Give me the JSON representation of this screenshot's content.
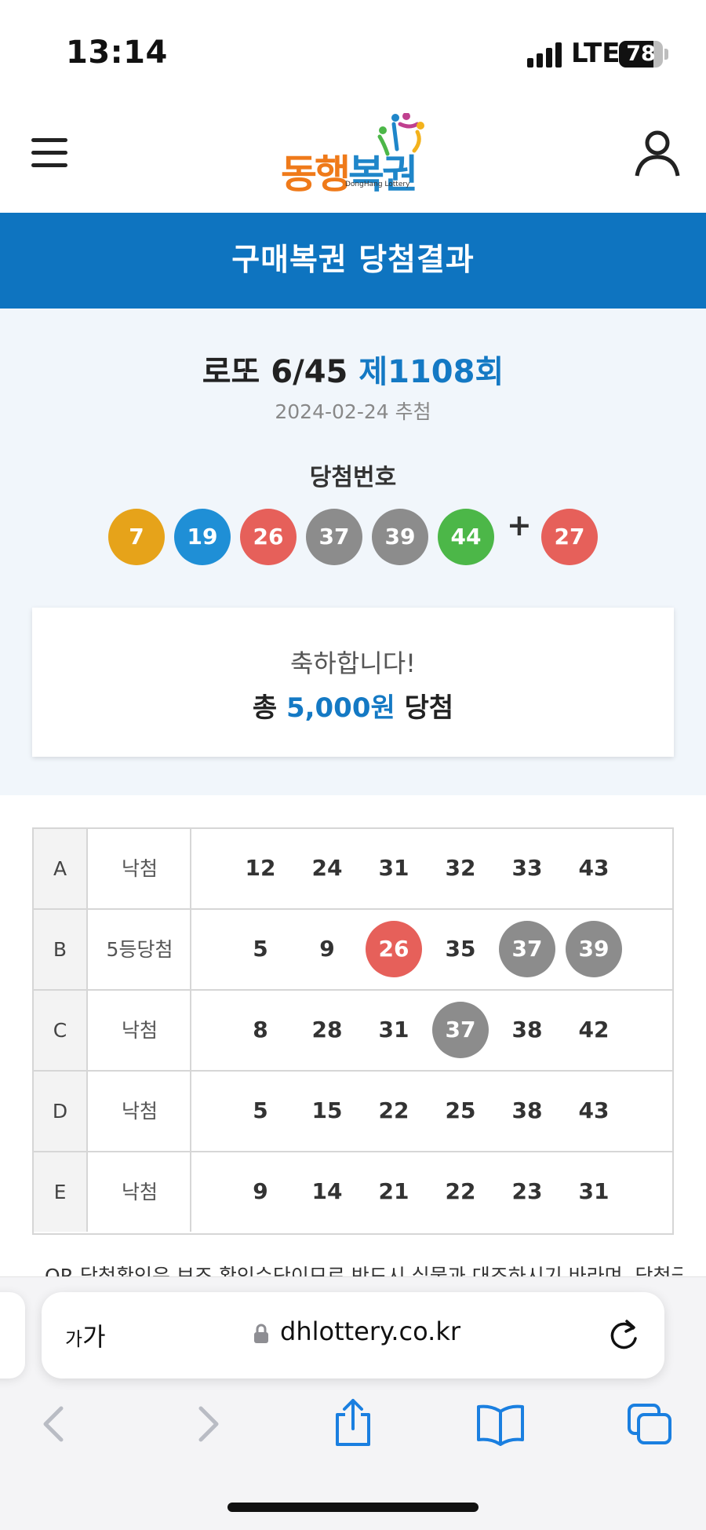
{
  "status_bar": {
    "time": "13:14",
    "network": "LTE",
    "battery": "78",
    "battery_level": 0.78
  },
  "header": {
    "logo_text_1": "동행",
    "logo_text_2": "복권",
    "logo_sub": "DongHang Lottery"
  },
  "title_bar": {
    "title": "구매복권 당첨결과"
  },
  "draw": {
    "title_prefix": "로또 6/45 ",
    "round": "제1108회",
    "date": "2024-02-24 추첨",
    "winning_label": "당첨번호",
    "numbers": [
      "7",
      "19",
      "26",
      "37",
      "39",
      "44"
    ],
    "plus": "+",
    "bonus": "27",
    "ball_colors": [
      "#e6a31a",
      "#1f8fd6",
      "#e6605a",
      "#8c8c8c",
      "#8c8c8c",
      "#4cb748",
      "#e6605a"
    ]
  },
  "prize": {
    "congrats": "축하합니다!",
    "prefix": "총 ",
    "amount": "5,000원",
    "suffix": " 당첨"
  },
  "games": [
    {
      "letter": "A",
      "result": "낙첨",
      "numbers": [
        "12",
        "24",
        "31",
        "32",
        "33",
        "43"
      ]
    },
    {
      "letter": "B",
      "result": "5등당첨",
      "numbers": [
        "5",
        "9",
        "26",
        "35",
        "37",
        "39"
      ]
    },
    {
      "letter": "C",
      "result": "낙첨",
      "numbers": [
        "8",
        "28",
        "31",
        "37",
        "38",
        "42"
      ]
    },
    {
      "letter": "D",
      "result": "낙첨",
      "numbers": [
        "5",
        "15",
        "22",
        "25",
        "38",
        "43"
      ]
    },
    {
      "letter": "E",
      "result": "낙첨",
      "numbers": [
        "9",
        "14",
        "21",
        "22",
        "23",
        "31"
      ]
    }
  ],
  "note": "- QR 당첨확인은 보조 확인수단이므로 반드시 실물과 대조하시기 바라며, 당첨금",
  "browser": {
    "text_size": "가",
    "text_size_small": "가",
    "url": "dhlottery.co.kr"
  },
  "colors": {
    "brand_blue": "#0e74c0",
    "accent_blue": "#1479c4",
    "logo_orange": "#ef7a1a"
  }
}
